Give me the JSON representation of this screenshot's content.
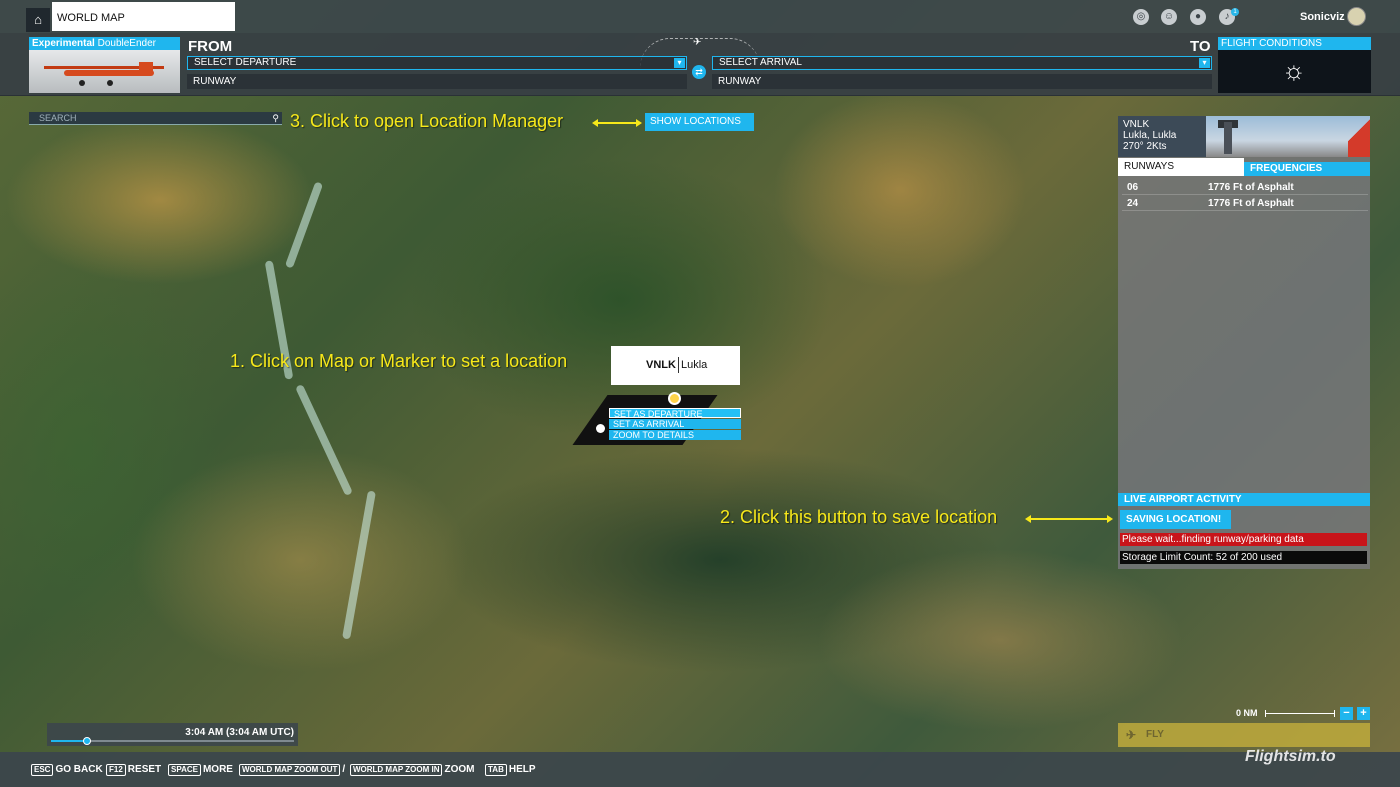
{
  "topbar": {
    "tab_label": "WORLD MAP",
    "username": "Sonicviz",
    "notification_count": "1"
  },
  "aircraft": {
    "brand": "Experimental",
    "model": "DoubleEnder"
  },
  "flightplan": {
    "from_label": "FROM",
    "to_label": "TO",
    "departure_placeholder": "SELECT DEPARTURE",
    "arrival_placeholder": "SELECT ARRIVAL",
    "departure_runway": "RUNWAY",
    "arrival_runway": "RUNWAY"
  },
  "conditions": {
    "title": "FLIGHT CONDITIONS",
    "icon": "sun-icon"
  },
  "search": {
    "placeholder": "SEARCH"
  },
  "show_locations_label": "SHOW LOCATIONS",
  "annotations": {
    "step1": "1. Click on Map or Marker to set  a location",
    "step2": "2. Click this button to save location",
    "step3": "3. Click to open Location Manager"
  },
  "map_popup": {
    "icao": "VNLK",
    "name": "Lukla",
    "menu": [
      "SET AS DEPARTURE",
      "SET AS ARRIVAL",
      "ZOOM TO DETAILS"
    ]
  },
  "airport_panel": {
    "icao": "VNLK",
    "location": "Lukla, Lukla",
    "wind": "270° 2Kts",
    "tabs": [
      "RUNWAYS",
      "FREQUENCIES"
    ],
    "runways": [
      {
        "number": "06",
        "description": "1776 Ft of Asphalt"
      },
      {
        "number": "24",
        "description": "1776 Ft of Asphalt"
      }
    ],
    "live_activity_label": "LIVE AIRPORT ACTIVITY",
    "saving_label": "SAVING LOCATION!",
    "wait_message": "Please wait...finding runway/parking data",
    "storage_message": "Storage Limit Count: 52 of 200 used"
  },
  "time": {
    "label": "3:04 AM (3:04 AM UTC)",
    "position_fraction": 0.15
  },
  "map_controls": {
    "scale_label": "0 NM",
    "zoom_out": "−",
    "zoom_in": "+"
  },
  "fly_label": "FLY",
  "bottombar": {
    "hints": [
      {
        "key": "ESC",
        "label": "GO BACK"
      },
      {
        "key": "F12",
        "label": "RESET"
      },
      {
        "key": "SPACE",
        "label": "MORE"
      },
      {
        "key": "WORLD MAP ZOOM OUT",
        "label": "/"
      },
      {
        "key": "WORLD MAP ZOOM IN",
        "label": "ZOOM"
      },
      {
        "key": "TAB",
        "label": "HELP"
      }
    ]
  },
  "watermark": "Flightsim.to",
  "colors": {
    "accent": "#1fb6ee",
    "annotation": "#f7e81a",
    "alert": "#c8141a"
  }
}
